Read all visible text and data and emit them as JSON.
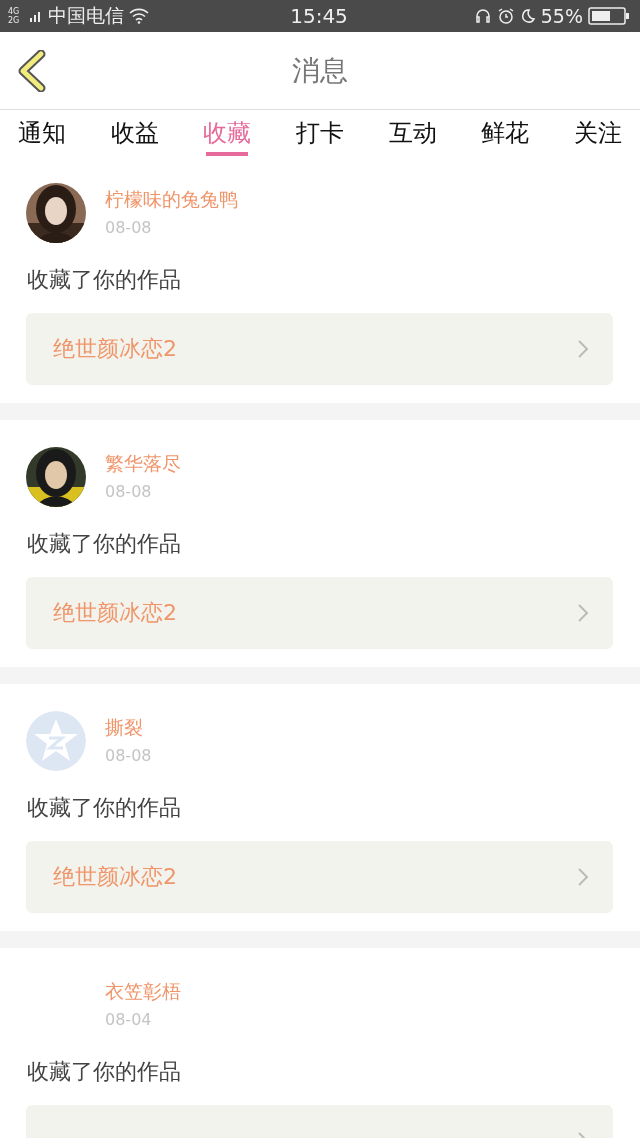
{
  "status_bar": {
    "network": "4G 2G",
    "carrier": "中国电信",
    "time": "15:45",
    "battery": "55%"
  },
  "header": {
    "title": "消息"
  },
  "tabs": [
    {
      "label": "通知",
      "selected": false
    },
    {
      "label": "收益",
      "selected": false
    },
    {
      "label": "收藏",
      "selected": true
    },
    {
      "label": "打卡",
      "selected": false
    },
    {
      "label": "互动",
      "selected": false
    },
    {
      "label": "鲜花",
      "selected": false
    },
    {
      "label": "关注",
      "selected": false
    }
  ],
  "messages": [
    {
      "name": "柠檬味的兔兔鸭",
      "date": "08-08",
      "action": "收藏了你的作品",
      "work": "绝世颜冰恋2"
    },
    {
      "name": "繁华落尽",
      "date": "08-08",
      "action": "收藏了你的作品",
      "work": "绝世颜冰恋2"
    },
    {
      "avatar": {
        "kind": "default"
      },
      "name": "撕裂",
      "date": "08-08",
      "action": "收藏了你的作品",
      "work": "绝世颜冰恋2"
    },
    {
      "avatar": {
        "kind": "none"
      },
      "name": "衣笠彰梧",
      "date": "08-04",
      "action": "收藏了你的作品"
    }
  ]
}
